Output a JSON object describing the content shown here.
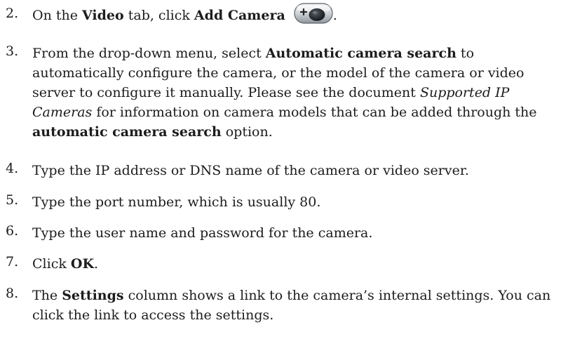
{
  "steps": [
    {
      "number": "2.",
      "text_a": "On the ",
      "bold_a": "Video",
      "text_b": " tab, click ",
      "bold_b": "Add Camera",
      "icon": "add-camera-icon",
      "tail": "."
    },
    {
      "number": "3.",
      "text_a": "From the drop-down menu, select ",
      "bold_a": "Automatic camera search",
      "text_b": " to automatically configure the camera, or the model of the camera or video server to configure it manually. Please see the document ",
      "italic_a": "Supported IP Cameras",
      "text_c": " for information on camera models that can be added through the ",
      "bold_b": "automatic camera search",
      "text_d": " option."
    },
    {
      "number": "4.",
      "text": "Type the IP address or DNS name of the camera or video server."
    },
    {
      "number": "5.",
      "text": "Type the port number, which is usually 80."
    },
    {
      "number": "6.",
      "text": "Type the user name and password for the camera."
    },
    {
      "number": "7.",
      "text_a": "Click ",
      "bold_a": "OK",
      "text_b": "."
    },
    {
      "number": "8.",
      "text_a": "The ",
      "bold_a": "Settings",
      "text_b": " column shows a link to the camera’s internal settings. You can click the link to access the settings."
    }
  ]
}
